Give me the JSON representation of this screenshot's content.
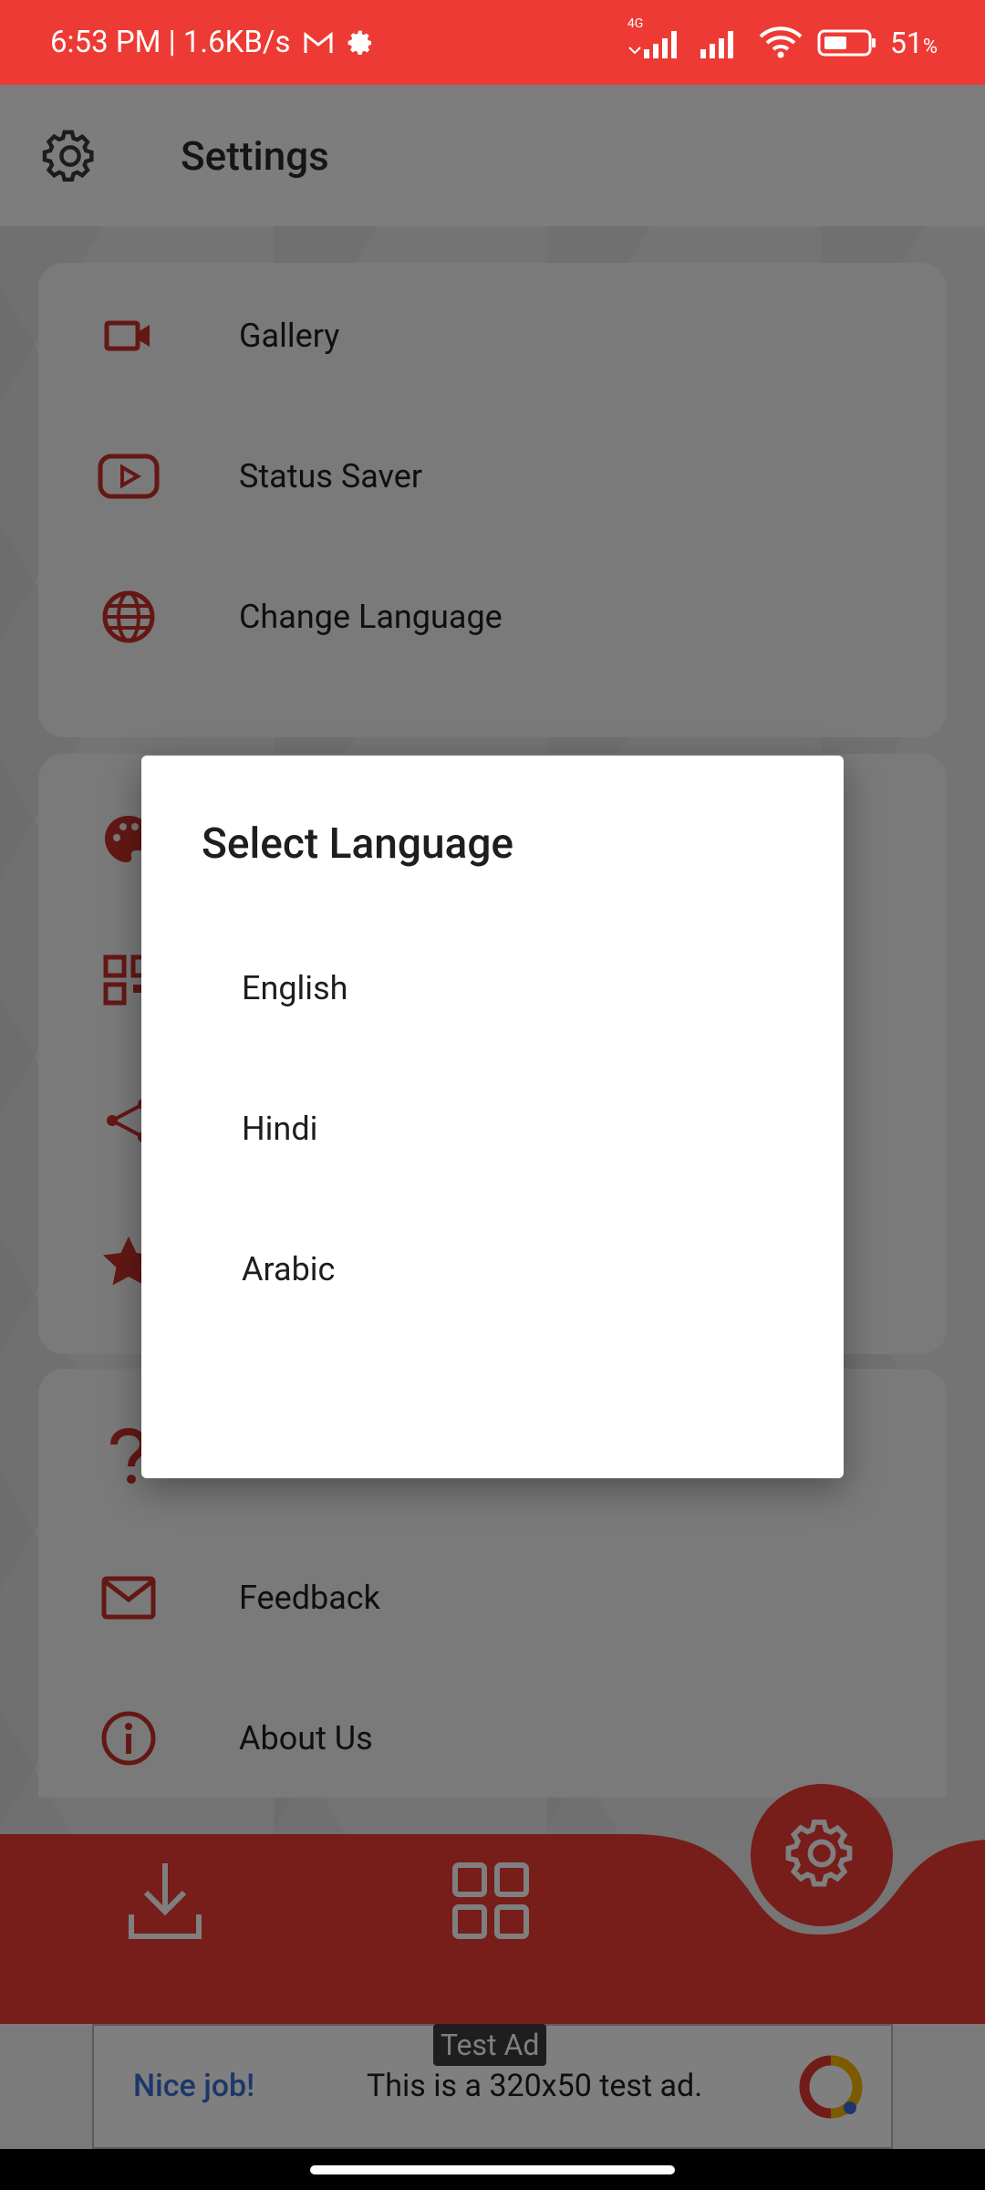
{
  "status_bar": {
    "time_speed": "6:53 PM | 1.6KB/s",
    "network_label": "4G",
    "battery": "51",
    "battery_unit": "%"
  },
  "app_bar": {
    "title": "Settings",
    "icon": "gear-icon"
  },
  "settings": {
    "card1": [
      {
        "label": "Gallery",
        "icon": "video-camera-icon"
      },
      {
        "label": "Status Saver",
        "icon": "youtube-play-icon"
      },
      {
        "label": "Change Language",
        "icon": "globe-icon"
      }
    ],
    "card2": [
      {
        "label": "",
        "icon": "palette-icon"
      },
      {
        "label": "",
        "icon": "qr-grid-icon"
      },
      {
        "label": "",
        "icon": "share-icon"
      },
      {
        "label": "",
        "icon": "star-icon"
      }
    ],
    "card3": [
      {
        "label": "",
        "icon": "question-icon"
      },
      {
        "label": "Feedback",
        "icon": "mail-icon"
      },
      {
        "label": "About Us",
        "icon": "info-icon"
      }
    ]
  },
  "dialog": {
    "title": "Select Language",
    "options": [
      "English",
      "Hindi",
      "Arabic"
    ]
  },
  "bottom_nav": {
    "items": [
      "download-icon",
      "grid-icon",
      "gear-icon"
    ]
  },
  "ad": {
    "tag": "Test Ad",
    "headline": "Nice job!",
    "text": "This is a 320x50 test ad."
  },
  "colors": {
    "accent": "#ee3a34",
    "card": "#f4f4f4",
    "background": "#e9e8e8"
  }
}
